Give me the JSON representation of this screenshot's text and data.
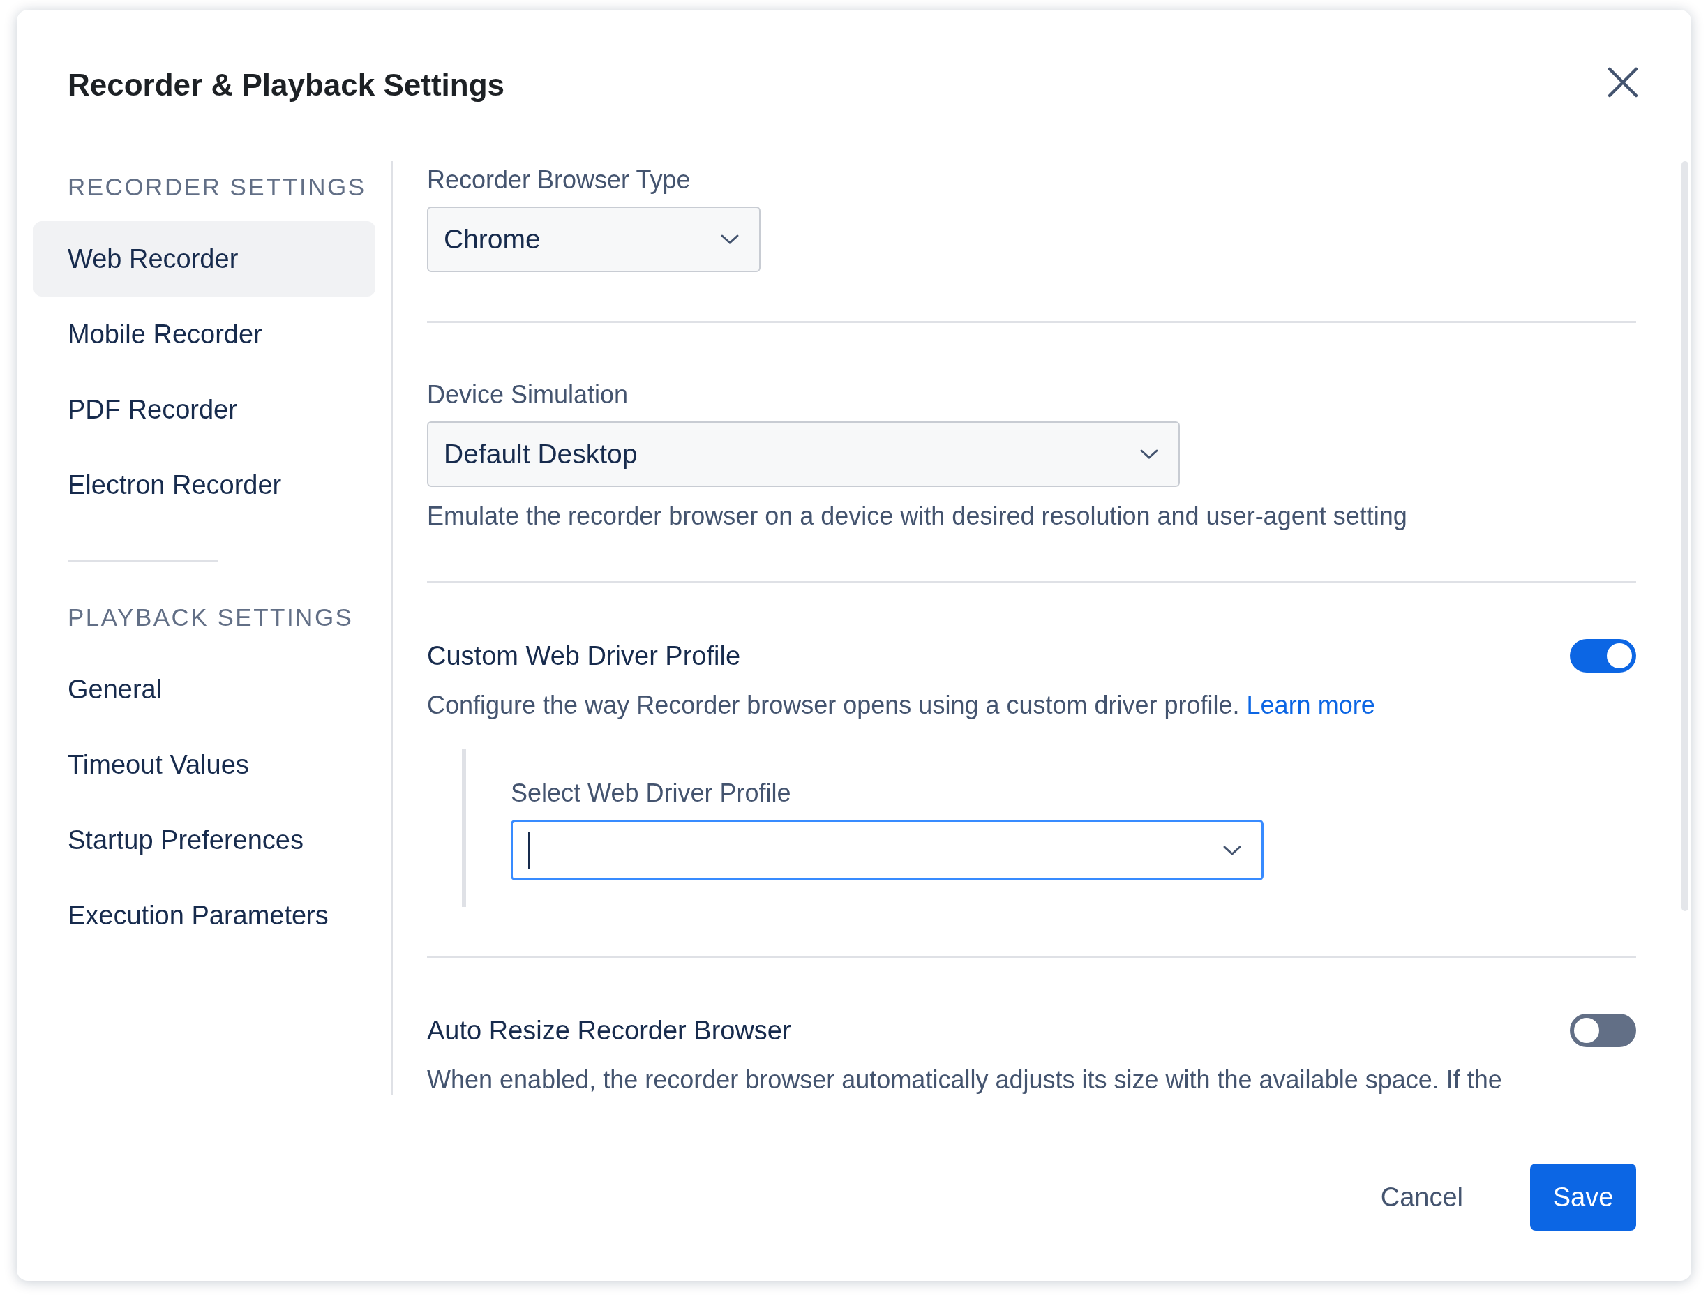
{
  "dialog": {
    "title": "Recorder & Playback Settings"
  },
  "sidebar": {
    "sections": [
      {
        "heading": "RECORDER SETTINGS",
        "items": [
          {
            "label": "Web Recorder",
            "selected": true
          },
          {
            "label": "Mobile Recorder",
            "selected": false
          },
          {
            "label": "PDF Recorder",
            "selected": false
          },
          {
            "label": "Electron Recorder",
            "selected": false
          }
        ]
      },
      {
        "heading": "PLAYBACK SETTINGS",
        "items": [
          {
            "label": "General",
            "selected": false
          },
          {
            "label": "Timeout Values",
            "selected": false
          },
          {
            "label": "Startup Preferences",
            "selected": false
          },
          {
            "label": "Execution Parameters",
            "selected": false
          }
        ]
      }
    ]
  },
  "settings": [
    {
      "kind": "select",
      "label": "Recorder Browser Type",
      "value": "Chrome"
    },
    {
      "kind": "select",
      "label": "Device Simulation",
      "value": "Default Desktop",
      "description": "Emulate the recorder browser on a device with desired resolution and user-agent setting"
    },
    {
      "kind": "toggle",
      "label": "Custom Web Driver Profile",
      "on": true,
      "description": "Configure the way Recorder browser opens using a custom driver profile.",
      "link": "Learn more",
      "nested": {
        "label": "Select Web Driver Profile",
        "focused": true
      }
    },
    {
      "kind": "toggle",
      "label": "Auto Resize Recorder Browser",
      "on": false,
      "description": "When enabled, the recorder browser automatically adjusts its size with the available space. If the"
    }
  ],
  "footer": {
    "buttons": [
      {
        "kind": "secondary",
        "label": "Cancel"
      },
      {
        "kind": "primary",
        "label": "Save"
      }
    ]
  }
}
